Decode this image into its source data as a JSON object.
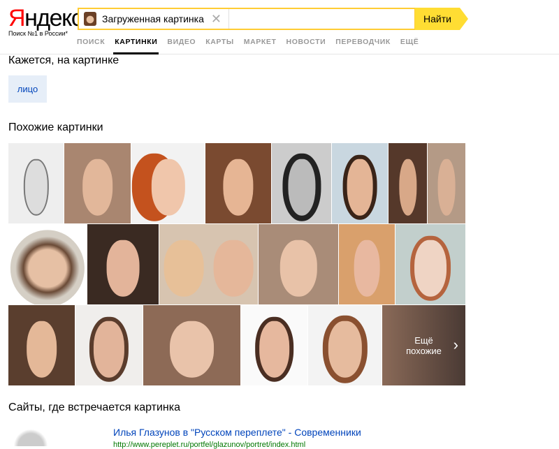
{
  "header": {
    "logo_red": "Я",
    "logo_rest": "ндекс",
    "slogan": "Поиск №1 в России*",
    "query": "Загруженная картинка",
    "search_button": "Найти",
    "nav": [
      "ПОИСК",
      "КАРТИНКИ",
      "ВИДЕО",
      "КАРТЫ",
      "МАРКЕТ",
      "НОВОСТИ",
      "ПЕРЕВОДЧИК",
      "ЕЩЁ"
    ]
  },
  "tags_title": "Кажется, на картинке",
  "tags": [
    "лицо"
  ],
  "similar_title": "Похожие картинки",
  "more_label_1": "Ещё",
  "more_label_2": "похожие",
  "sites_title": "Сайты, где встречается картинка",
  "results": [
    {
      "title": "Илья Глазунов в \"Русском переплете\" - Современники",
      "url": "http://www.pereplet.ru/portfel/glazunov/portret/index.html"
    }
  ]
}
